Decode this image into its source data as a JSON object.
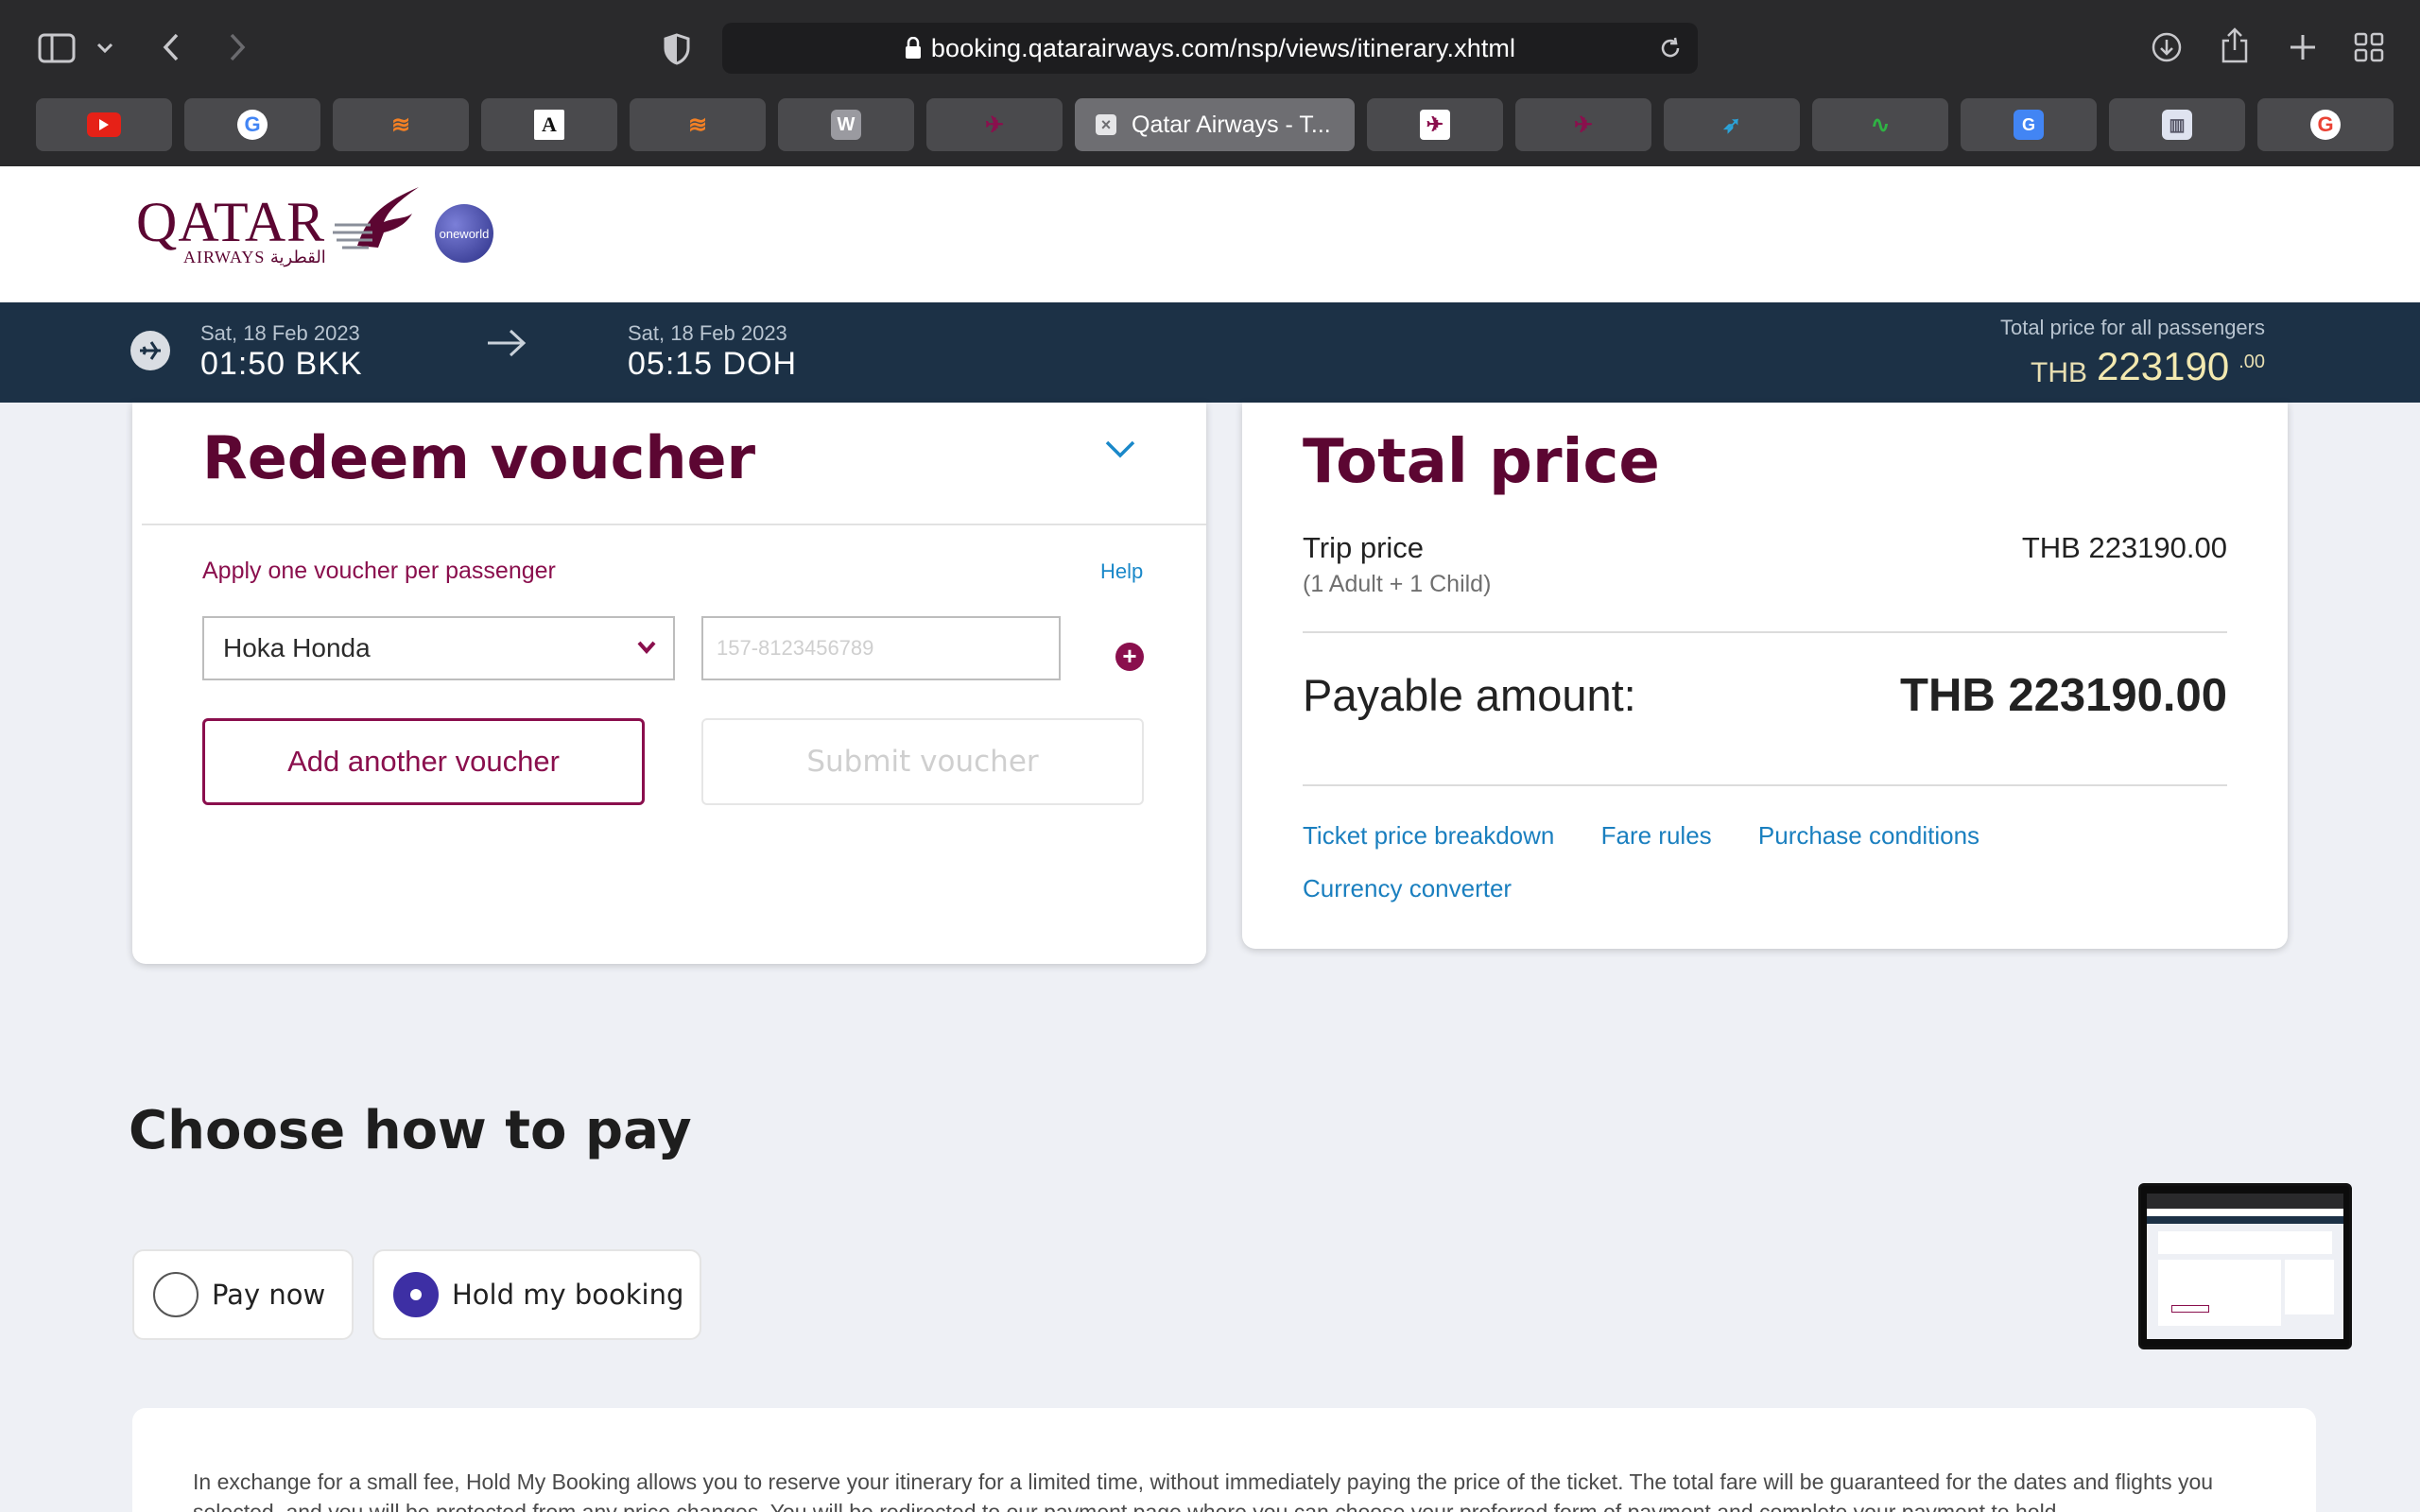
{
  "browser": {
    "url": "booking.qatarairways.com/nsp/views/itinerary.xhtml",
    "active_tab_title": "Qatar Airways - T...",
    "tabs": [
      {
        "icon": "youtube-icon"
      },
      {
        "icon": "google-icon"
      },
      {
        "icon": "stackoverflow-icon"
      },
      {
        "icon": "letter-a-icon"
      },
      {
        "icon": "stackoverflow-icon"
      },
      {
        "icon": "letter-w-icon"
      },
      {
        "icon": "qatar-airways-icon"
      },
      {
        "icon": "close-icon",
        "active": true
      },
      {
        "icon": "qatar-airways-icon"
      },
      {
        "icon": "qatar-airways-icon"
      },
      {
        "icon": "bird-icon"
      },
      {
        "icon": "chart-icon"
      },
      {
        "icon": "google-translate-icon"
      },
      {
        "icon": "reader-icon"
      },
      {
        "icon": "google-icon"
      }
    ]
  },
  "header": {
    "logo_text": "QATAR",
    "logo_sub": "AIRWAYS القطرية",
    "oneworld": "oneworld"
  },
  "flight": {
    "departure_date": "Sat, 18 Feb 2023",
    "departure_time": "01:50 BKK",
    "arrival_date": "Sat, 18 Feb 2023",
    "arrival_time": "05:15 DOH",
    "total_label": "Total price for all passengers",
    "total_currency": "THB",
    "total_amount": "223190",
    "total_decimals": ".00"
  },
  "voucher": {
    "title": "Redeem voucher",
    "apply_text": "Apply one voucher per passenger",
    "help": "Help",
    "passenger": "Hoka Honda",
    "voucher_placeholder": "157-8123456789",
    "add_label": "Add another voucher",
    "submit_label": "Submit voucher"
  },
  "price": {
    "title": "Total price",
    "trip_label": "Trip price",
    "passengers": "(1 Adult + 1 Child)",
    "trip_value": "THB 223190.00",
    "payable_label": "Payable amount:",
    "payable_value": "THB 223190.00",
    "links": [
      "Ticket price breakdown",
      "Fare rules",
      "Purchase conditions",
      "Currency converter"
    ]
  },
  "payment": {
    "title": "Choose how to pay",
    "options": [
      {
        "label": "Pay now",
        "selected": false
      },
      {
        "label": "Hold my booking",
        "selected": true
      }
    ],
    "info": "In exchange for a small fee, Hold My Booking allows you to reserve your itinerary for a limited time, without immediately paying the price of the ticket. The total fare will be guaranteed for the dates and flights you selected, and you will be protected from any price changes. You will be redirected to our payment page where you can choose your preferred form of payment and complete your payment to hold"
  },
  "colors": {
    "brand": "#5c0632",
    "accent": "#8a0f4d",
    "link": "#1a7fbf",
    "flight_bar": "#1c3146",
    "radio_selected": "#3d2fa4"
  }
}
